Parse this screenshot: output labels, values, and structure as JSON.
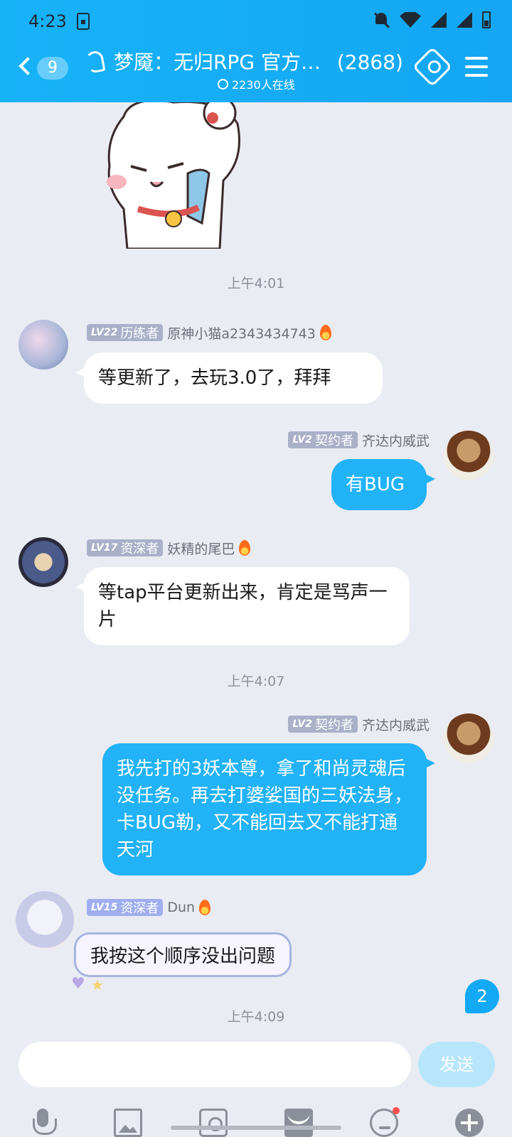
{
  "status_bar": {
    "time": "4:23"
  },
  "header": {
    "back_count": "9",
    "title": "梦魇：无归RPG 官方…",
    "member_count": "(2868)",
    "online": "2230人在线"
  },
  "messages": [
    {
      "time": "上午4:01"
    },
    {
      "side": "in",
      "level": "LV22",
      "rank": "历练者",
      "name": "原神小猫a2343434743",
      "text": "等更新了，去玩3.0了，拜拜"
    },
    {
      "side": "out",
      "level": "LV2",
      "rank": "契约者",
      "name": "齐达内威武",
      "text": "有BUG"
    },
    {
      "side": "in",
      "level": "LV17",
      "rank": "资深者",
      "name": "妖精的尾巴",
      "text": "等tap平台更新出来，肯定是骂声一片"
    },
    {
      "time": "上午4:07"
    },
    {
      "side": "out",
      "level": "LV2",
      "rank": "契约者",
      "name": "齐达内威武",
      "text": "我先打的3妖本尊，拿了和尚灵魂后没任务。再去打婆娑国的三妖法身，卡BUG勒，又不能回去又不能打通天河"
    },
    {
      "side": "in",
      "level": "LV15",
      "rank": "资深者",
      "name": "Dun",
      "text": "我按这个顺序没出问题"
    },
    {
      "time": "上午4:09"
    }
  ],
  "unread_badge": "2",
  "input": {
    "value": "",
    "send_label": "发送"
  },
  "colors": {
    "header": "#17b3f7",
    "outgoing_bubble": "#22b2f7",
    "background": "#eaecf3"
  },
  "toolbar_icons": [
    "mic-icon",
    "image-icon",
    "camera-icon",
    "red-packet-icon",
    "emoji-icon",
    "plus-icon"
  ]
}
